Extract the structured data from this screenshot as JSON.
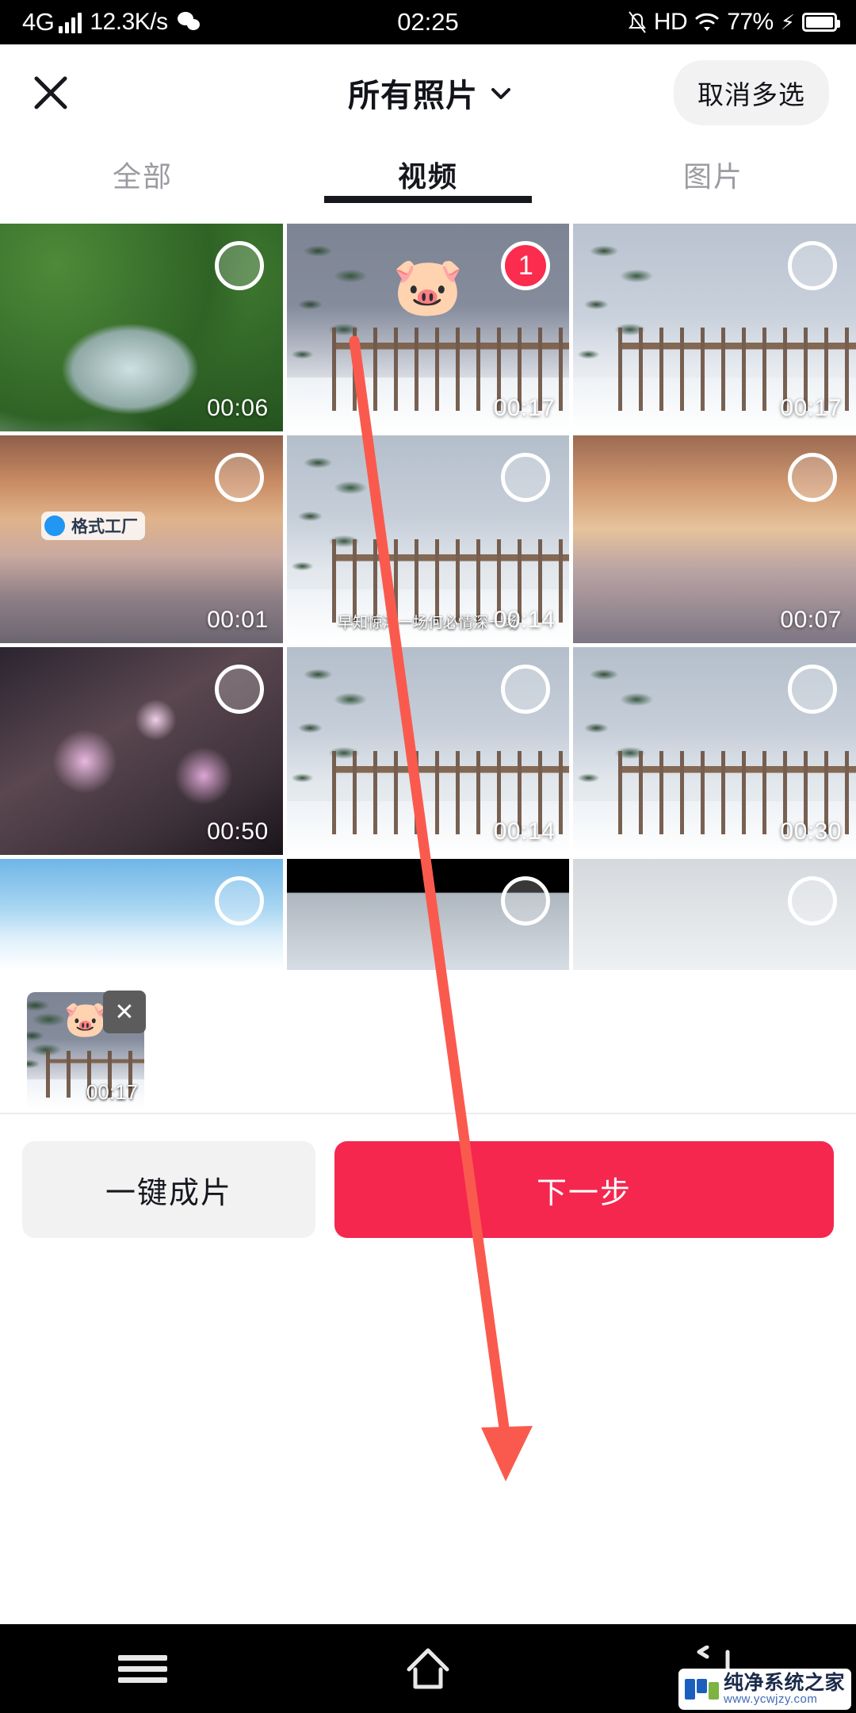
{
  "status_bar": {
    "network_type": "4G",
    "speed": "12.3K/s",
    "time": "02:25",
    "hd_label": "HD",
    "battery_percent": "77%",
    "icons": [
      "signal-bars-icon",
      "wechat-icon",
      "mute-icon",
      "hd-icon",
      "wifi-icon",
      "charging-bolt-icon",
      "battery-icon"
    ]
  },
  "header": {
    "close_label": "✕",
    "title": "所有照片",
    "multi_select_label": "取消多选"
  },
  "tabs": [
    {
      "label": "全部",
      "active": false
    },
    {
      "label": "视频",
      "active": true
    },
    {
      "label": "图片",
      "active": false
    }
  ],
  "grid": {
    "rows": [
      [
        {
          "duration": "00:06",
          "selected": false,
          "badge": "",
          "theme": "waterfall"
        },
        {
          "duration": "00:17",
          "selected": true,
          "badge": "1",
          "theme": "snowrail",
          "emoji": "🐷"
        },
        {
          "duration": "00:17",
          "selected": false,
          "badge": "",
          "theme": "snowrail2"
        }
      ],
      [
        {
          "duration": "00:01",
          "selected": false,
          "badge": "",
          "theme": "sunsettree",
          "watermark": "格式工厂"
        },
        {
          "duration": "00:14",
          "selected": false,
          "badge": "",
          "theme": "snowbridge",
          "caption": "早知惊鸿一场何必情深一场"
        },
        {
          "duration": "00:07",
          "selected": false,
          "badge": "",
          "theme": "sunsettree2"
        }
      ],
      [
        {
          "duration": "00:50",
          "selected": false,
          "badge": "",
          "theme": "blossom"
        },
        {
          "duration": "00:14",
          "selected": false,
          "badge": "",
          "theme": "snowbridge"
        },
        {
          "duration": "00:30",
          "selected": false,
          "badge": "",
          "theme": "snowbridge"
        }
      ],
      [
        {
          "duration": "",
          "selected": false,
          "badge": "",
          "theme": "birds"
        },
        {
          "duration": "",
          "selected": false,
          "badge": "",
          "theme": "darkrail"
        },
        {
          "duration": "",
          "selected": false,
          "badge": "",
          "theme": "fog"
        }
      ]
    ]
  },
  "tray": {
    "item_duration": "00:17",
    "item_emoji": "🐷",
    "remove_label": "✕"
  },
  "actions": {
    "auto_label": "一键成片",
    "next_label": "下一步"
  },
  "navbar": {
    "menu_icon": "hamburger-menu-icon",
    "home_icon": "home-icon",
    "back_icon": "back-icon"
  },
  "watermark": {
    "title": "纯净系统之家",
    "url": "www.ycwjzy.com"
  },
  "annotation": {
    "arrow_color": "#fa5a4e"
  }
}
